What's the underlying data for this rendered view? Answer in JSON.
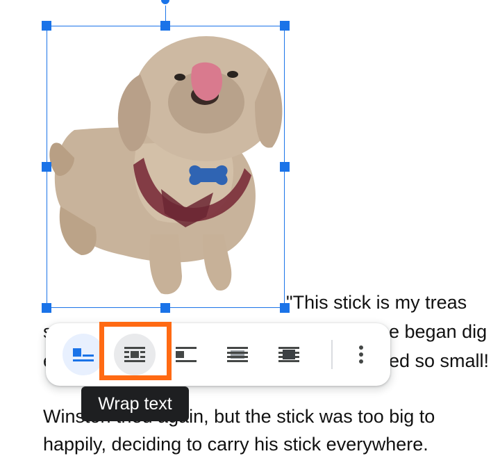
{
  "document": {
    "line1_right": "\"This stick is my treas",
    "line2_left": "s",
    "line2_right": "e began dig",
    "line3_left": "e",
    "line3_right": "ed so small!",
    "line4": "Winston tried again, but the stick was too big to",
    "line5": "happily, deciding to carry his stick everywhere."
  },
  "image": {
    "alt": "Photo of a fluffy tan dog licking its nose, wearing a red harness with a blue bone tag"
  },
  "toolbar": {
    "buttons": [
      {
        "icon": "in-line-icon",
        "state": "selected"
      },
      {
        "icon": "wrap-text-icon",
        "state": "hover"
      },
      {
        "icon": "break-text-icon",
        "state": "normal"
      },
      {
        "icon": "behind-text-icon",
        "state": "normal"
      },
      {
        "icon": "in-front-of-text-icon",
        "state": "normal"
      },
      {
        "icon": "more-vert-icon",
        "state": "normal"
      }
    ],
    "tooltip": "Wrap text",
    "highlight_color": "#ff6a13",
    "accent_color": "#1a73e8"
  }
}
